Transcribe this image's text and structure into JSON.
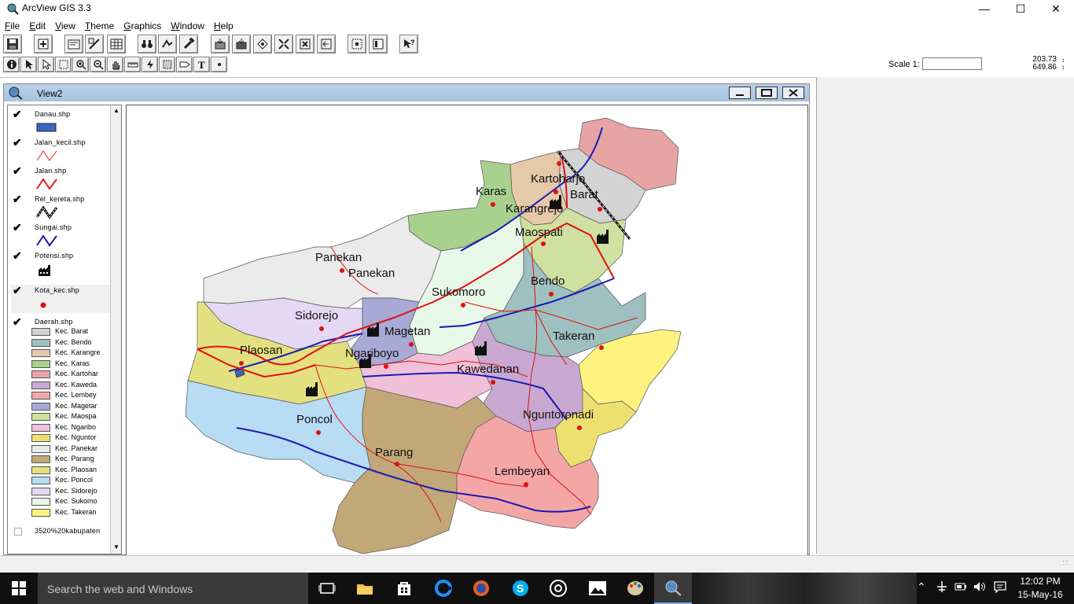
{
  "window": {
    "title": "ArcView GIS 3.3"
  },
  "menu": [
    {
      "label": "File",
      "key": "F"
    },
    {
      "label": "Edit",
      "key": "E"
    },
    {
      "label": "View",
      "key": "V"
    },
    {
      "label": "Theme",
      "key": "T"
    },
    {
      "label": "Graphics",
      "key": "G"
    },
    {
      "label": "Window",
      "key": "W"
    },
    {
      "label": "Help",
      "key": "H"
    }
  ],
  "scale": {
    "label": "Scale 1:",
    "value": ""
  },
  "coords": {
    "x": "203.73",
    "y": "649.86"
  },
  "view": {
    "title": "View2"
  },
  "toc": {
    "layers": [
      {
        "name": "Danau.shp",
        "checked": "✔",
        "symbol": "fill-blue"
      },
      {
        "name": "Jalan_kecil.shp",
        "checked": "✔",
        "symbol": "line-thin-red"
      },
      {
        "name": "Jalan.shp",
        "checked": "✔",
        "symbol": "line-red"
      },
      {
        "name": "Rel_kereta.shp",
        "checked": "✔",
        "symbol": "rail-line"
      },
      {
        "name": "Sungai.shp",
        "checked": "✔",
        "symbol": "line-blue"
      },
      {
        "name": "Potensi.shp",
        "checked": "✔",
        "symbol": "factory-icon"
      },
      {
        "name": "Kota_kec.shp",
        "checked": "✔",
        "symbol": "red-dot"
      },
      {
        "name": "Daerah.shp",
        "checked": "✔",
        "symbol": "legend"
      },
      {
        "name": "3520%20kabupaten",
        "checked": "",
        "symbol": "none"
      }
    ],
    "legend": [
      {
        "label": "Kec. Barat",
        "color": "#d3d3d3"
      },
      {
        "label": "Kec. Bendo",
        "color": "#9ec0c0"
      },
      {
        "label": "Kec. Karangre",
        "color": "#e6c9a8"
      },
      {
        "label": "Kec. Karas",
        "color": "#a9d18e"
      },
      {
        "label": "Kec. Kartohar",
        "color": "#e6a4a4"
      },
      {
        "label": "Kec. Kaweda",
        "color": "#c8a8d0"
      },
      {
        "label": "Kec. Lembey",
        "color": "#f4a6a6"
      },
      {
        "label": "Kec. Magetar",
        "color": "#a9a9d6"
      },
      {
        "label": "Kec. Maospa",
        "color": "#cfe0a0"
      },
      {
        "label": "Kec. Ngaribo",
        "color": "#f0c0d8"
      },
      {
        "label": "Kec. Nguntor",
        "color": "#eee070"
      },
      {
        "label": "Kec. Panekar",
        "color": "#ebebeb"
      },
      {
        "label": "Kec. Parang",
        "color": "#c2a878"
      },
      {
        "label": "Kec. Plaosan",
        "color": "#e3e080"
      },
      {
        "label": "Kec. Poncol",
        "color": "#b8dcf4"
      },
      {
        "label": "Kec. Sidorejo",
        "color": "#e4d8f4"
      },
      {
        "label": "Kec. Sukomo",
        "color": "#e8f8e8"
      },
      {
        "label": "Kec. Takeran",
        "color": "#fff380"
      }
    ]
  },
  "map": {
    "labels": [
      {
        "text": "Kartoharjo"
      },
      {
        "text": "Barat"
      },
      {
        "text": "Karas"
      },
      {
        "text": "Karangrejo"
      },
      {
        "text": "Maospati"
      },
      {
        "text": "Panekan"
      },
      {
        "text": "Panekan"
      },
      {
        "text": "Bendo"
      },
      {
        "text": "Sukomoro"
      },
      {
        "text": "Sidorejo"
      },
      {
        "text": "Magetan"
      },
      {
        "text": "Takeran"
      },
      {
        "text": "Plaosan"
      },
      {
        "text": "Ngariboyo"
      },
      {
        "text": "Kawedanan"
      },
      {
        "text": "Poncol"
      },
      {
        "text": "Nguntoronadi"
      },
      {
        "text": "Parang"
      },
      {
        "text": "Lembeyan"
      }
    ]
  },
  "taskbar": {
    "search_placeholder": "Search the web and Windows",
    "time": "12:02 PM",
    "date": "15-May-16"
  }
}
